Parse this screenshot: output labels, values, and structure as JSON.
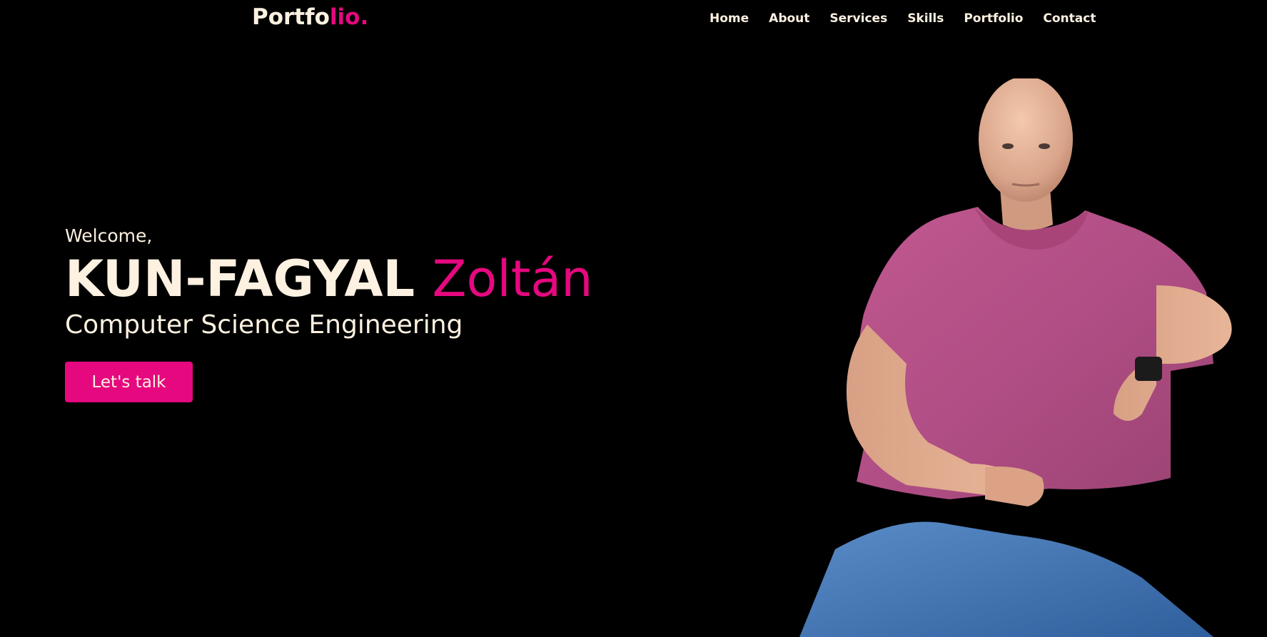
{
  "header": {
    "logo_main": "Portfo",
    "logo_accent": "lio.",
    "nav": [
      {
        "label": "Home"
      },
      {
        "label": "About"
      },
      {
        "label": "Services"
      },
      {
        "label": "Skills"
      },
      {
        "label": "Portfolio"
      },
      {
        "label": "Contact"
      }
    ]
  },
  "hero": {
    "greeting": "Welcome,",
    "last_name": "KUN-FAGYAL",
    "first_name": "Zoltán",
    "role": "Computer Science Engineering",
    "cta_label": "Let's talk"
  },
  "colors": {
    "background": "#000000",
    "text": "#fdf1e1",
    "accent": "#e6087f"
  }
}
